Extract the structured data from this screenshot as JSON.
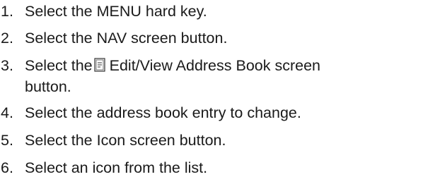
{
  "steps": [
    {
      "number": "1.",
      "text": "Select the MENU hard key."
    },
    {
      "number": "2.",
      "text": "Select the NAV screen button."
    },
    {
      "number": "3.",
      "text_before": "Select the",
      "icon": "address-book-icon",
      "text_after": "Edit/View Address Book screen",
      "text_line2": "button."
    },
    {
      "number": "4.",
      "text": "Select the address book entry to change."
    },
    {
      "number": "5.",
      "text": "Select the Icon screen button."
    },
    {
      "number": "6.",
      "text": "Select an icon from the list."
    }
  ]
}
